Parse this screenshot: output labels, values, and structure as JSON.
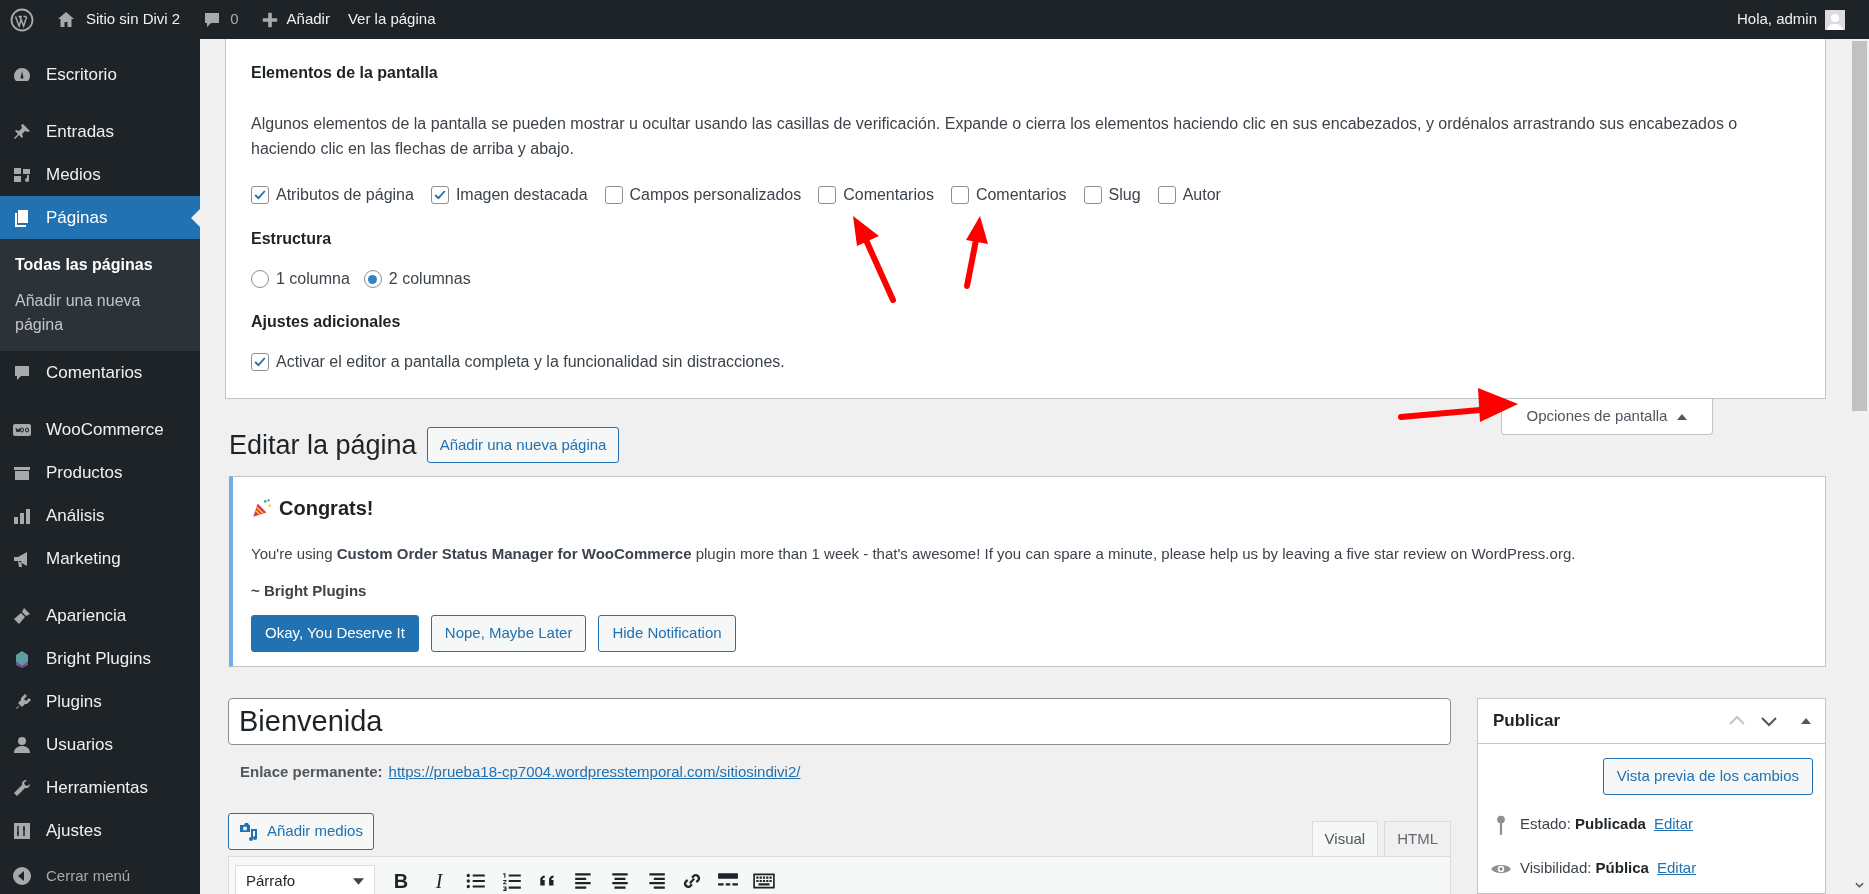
{
  "admin_bar": {
    "site_name": "Sitio sin Divi 2",
    "comments_count": "0",
    "new_label": "Añadir",
    "view_label": "Ver la página",
    "greeting": "Hola, admin"
  },
  "sidebar": {
    "groups": [
      [
        {
          "label": "Escritorio",
          "selected": false
        }
      ],
      [
        {
          "label": "Entradas",
          "selected": false
        },
        {
          "label": "Medios",
          "selected": false
        },
        {
          "label": "Páginas",
          "selected": true,
          "children": [
            {
              "label": "Todas las páginas",
              "selected": true
            },
            {
              "label": "Añadir una nueva página",
              "selected": false
            }
          ]
        },
        {
          "label": "Comentarios",
          "selected": false
        }
      ],
      [
        {
          "label": "WooCommerce",
          "selected": false
        },
        {
          "label": "Productos",
          "selected": false
        },
        {
          "label": "Análisis",
          "selected": false
        },
        {
          "label": "Marketing",
          "selected": false
        }
      ],
      [
        {
          "label": "Apariencia",
          "selected": false
        },
        {
          "label": "Bright Plugins",
          "selected": false
        },
        {
          "label": "Plugins",
          "selected": false
        },
        {
          "label": "Usuarios",
          "selected": false
        },
        {
          "label": "Herramientas",
          "selected": false
        },
        {
          "label": "Ajustes",
          "selected": false
        }
      ]
    ],
    "collapse_label": "Cerrar menú"
  },
  "screen_options": {
    "expanded": true,
    "heading": "Elementos de la pantalla",
    "description": "Algunos elementos de la pantalla se pueden mostrar u ocultar usando las casillas de verificación. Expande o cierra los elementos haciendo clic en sus encabezados, y ordénalos arrastrando sus encabezados o haciendo clic en las flechas de arriba y abajo.",
    "checkboxes": [
      {
        "label": "Atributos de página",
        "checked": true
      },
      {
        "label": "Imagen destacada",
        "checked": true
      },
      {
        "label": "Campos personalizados",
        "checked": false
      },
      {
        "label": "Comentarios",
        "checked": false
      },
      {
        "label": "Comentarios",
        "checked": false
      },
      {
        "label": "Slug",
        "checked": false
      },
      {
        "label": "Autor",
        "checked": false
      }
    ],
    "layout_heading": "Estructura",
    "layout_options": [
      {
        "label": "1 columna",
        "selected": false
      },
      {
        "label": "2 columnas",
        "selected": true
      }
    ],
    "additional_heading": "Ajustes adicionales",
    "additional_options": [
      {
        "label": "Activar el editor a pantalla completa y la funcionalidad sin distracciones.",
        "checked": true
      }
    ],
    "toggle_label": "Opciones de pantalla"
  },
  "page_title": "Editar la página",
  "add_new_button": "Añadir una nueva página",
  "notice": {
    "title": "Congrats!",
    "message": "You're using **Custom Order Status Manager for WooCommerce** plugin more than 1 week - that's awesome! If you can spare a minute, please help us by leaving a five star review on WordPress.org.",
    "signature": "~ Bright Plugins",
    "buttons": [
      {
        "label": "Okay, You Deserve It",
        "kind": "primary"
      },
      {
        "label": "Nope, Maybe Later",
        "kind": "secondary"
      },
      {
        "label": "Hide Notification",
        "kind": "secondary"
      }
    ]
  },
  "editor": {
    "title_value": "Bienvenida",
    "permalink_label": "Enlace permanente:",
    "permalink_url": "https://prueba18-cp7004.wordpresstemporal.com/sitiosindivi2/",
    "add_media_label": "Añadir medios",
    "tabs": [
      {
        "label": "Visual",
        "selected": true
      },
      {
        "label": "HTML",
        "selected": false
      }
    ],
    "format_select": "Párrafo",
    "format_buttons": [
      "B",
      "I"
    ]
  },
  "publish_box": {
    "title": "Publicar",
    "preview_button": "Vista previa de los cambios",
    "rows": [
      {
        "label": "Estado:",
        "value": "Publicada",
        "link": "Editar"
      },
      {
        "label": "Visibilidad:",
        "value": "Pública",
        "link": "Editar"
      }
    ]
  }
}
